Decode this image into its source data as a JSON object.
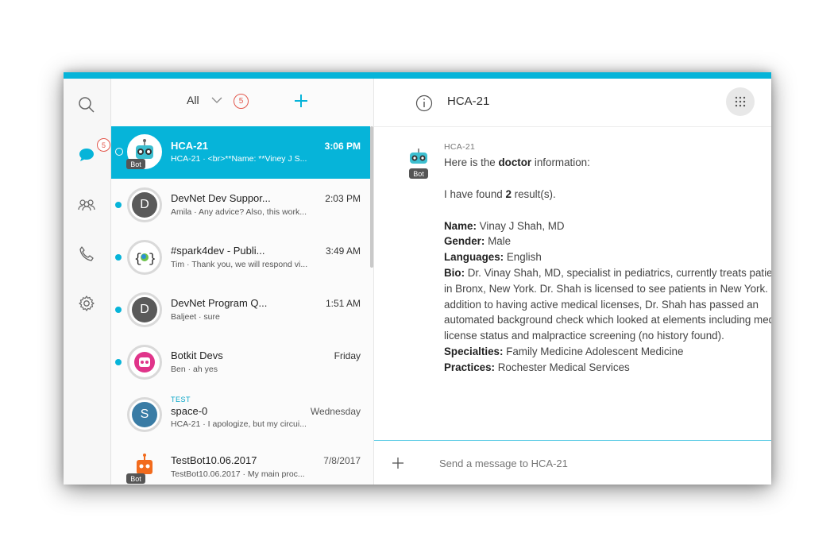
{
  "rail": {
    "chat_badge": "5",
    "icons": [
      "search-icon",
      "chat-icon",
      "people-icon",
      "phone-icon",
      "gear-icon"
    ]
  },
  "list": {
    "filter_label": "All",
    "unread_badge": "5",
    "items": [
      {
        "title": "HCA-21",
        "time": "3:06 PM",
        "sub": "HCA-21 · <br>**Name: **Viney J S...",
        "bot": "Bot",
        "active": true
      },
      {
        "title": "DevNet Dev Suppor...",
        "time": "2:03 PM",
        "sub": "Amila · Any advice? Also, this work...",
        "initial": "D"
      },
      {
        "title": "#spark4dev - Publi...",
        "time": "3:49 AM",
        "sub": "Tim · Thank you, we will respond vi..."
      },
      {
        "title": "DevNet Program Q...",
        "time": "1:51 AM",
        "sub": "Baljeet · sure",
        "initial": "D"
      },
      {
        "title": "Botkit Devs",
        "time": "Friday",
        "sub": "Ben · ah yes"
      },
      {
        "tag": "TEST",
        "title": "space-0",
        "time": "Wednesday",
        "sub": "HCA-21 · I apologize, but my circui...",
        "initial": "S"
      },
      {
        "title": "TestBot10.06.2017",
        "time": "7/8/2017",
        "sub": "TestBot10.06.2017 · My main proc...",
        "bot": "Bot"
      }
    ]
  },
  "main": {
    "room_title": "HCA-21",
    "message": {
      "sender": "HCA-21",
      "bot_tag": "Bot",
      "line1_pre": "Here is the ",
      "line1_bold": "doctor",
      "line1_post": " information:",
      "line2_pre": "I have found ",
      "line2_bold": "2",
      "line2_post": " result(s).",
      "fields": [
        {
          "label": "Name:",
          "value": " Vinay J Shah, MD"
        },
        {
          "label": "Gender:",
          "value": " Male"
        },
        {
          "label": "Languages:",
          "value": " English"
        },
        {
          "label": "Bio:",
          "value": " Dr. Vinay Shah, MD, specialist in pediatrics, currently treats patients in Bronx, New York.  Dr. Shah is licensed to see patients in New York.  In addition to having active medical licenses, Dr. Shah has passed an automated background check which looked at elements including medical license status and malpractice screening (no history found)."
        },
        {
          "label": "Specialties:",
          "value": " Family Medicine Adolescent Medicine"
        },
        {
          "label": "Practices:",
          "value": " Rochester Medical Services"
        }
      ]
    },
    "composer_placeholder": "Send a message to HCA-21"
  },
  "colors": {
    "accent": "#06b4d9",
    "badge": "#e2574c"
  }
}
